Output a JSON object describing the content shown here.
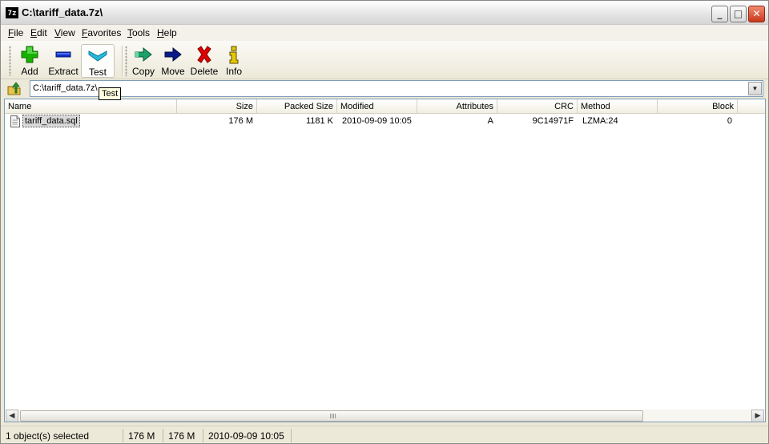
{
  "window": {
    "title": "C:\\tariff_data.7z\\",
    "icon_text": "7z",
    "controls": {
      "minimize": "_",
      "maximize": "□",
      "close": "✕"
    }
  },
  "menu": [
    "File",
    "Edit",
    "View",
    "Favorites",
    "Tools",
    "Help"
  ],
  "toolbar": {
    "add": "Add",
    "extract": "Extract",
    "test": "Test",
    "copy": "Copy",
    "move": "Move",
    "delete": "Delete",
    "info": "Info"
  },
  "address": {
    "value": "C:\\tariff_data.7z\\",
    "dropdown_icon": "▼"
  },
  "tooltip": "Test",
  "columns": {
    "name": "Name",
    "size": "Size",
    "packed": "Packed Size",
    "modified": "Modified",
    "attributes": "Attributes",
    "crc": "CRC",
    "method": "Method",
    "block": "Block"
  },
  "files": [
    {
      "name": "tariff_data.sql",
      "size": "176 M",
      "packed": "1181 K",
      "modified": "2010-09-09 10:05",
      "attributes": "A",
      "crc": "9C14971F",
      "method": "LZMA:24",
      "block": "0"
    }
  ],
  "scroll": {
    "left": "◀",
    "right": "▶"
  },
  "status": {
    "selected": "1 object(s) selected",
    "size": "176 M",
    "total": "176 M",
    "modified": "2010-09-09 10:05"
  },
  "colors": {
    "add": "#19b000",
    "extract": "#1030c8",
    "test": "#2ab7d8",
    "copy": "#1aa06a",
    "move": "#0a1c8a",
    "delete": "#e00000",
    "info": "#e8c800"
  }
}
